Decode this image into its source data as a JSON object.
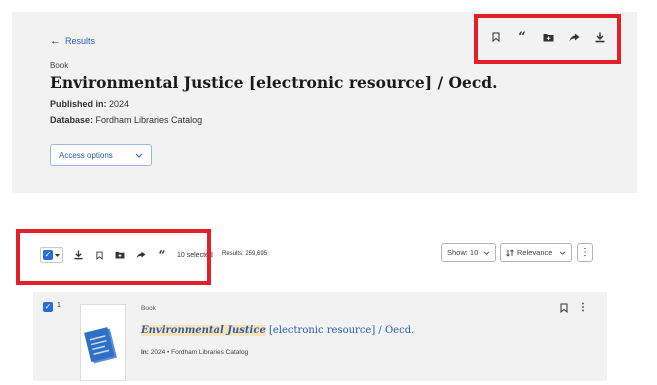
{
  "record": {
    "back_label": "Results",
    "type": "Book",
    "title": "Environmental Justice [electronic resource] / Oecd.",
    "published_label": "Published in:",
    "published_value": " 2024",
    "database_label": "Database:",
    "database_value": " Fordham Libraries Catalog",
    "access_button": "Access options",
    "actions": [
      "bookmark-icon",
      "cite-icon",
      "folder-icon",
      "share-icon",
      "download-icon"
    ]
  },
  "toolbar": {
    "selected_text": "10 selected",
    "results_text": "Results: 259,695",
    "show_label": "Show: 10",
    "sort_label": "Relevance"
  },
  "result": {
    "number": "1",
    "type": "Book",
    "title_highlight": "Environmental Justice",
    "title_rest": " [electronic resource] / Oecd.",
    "meta_label": "In:",
    "meta_value": " 2024 • Fordham Libraries Catalog"
  },
  "colors": {
    "accent": "#2a6cdb",
    "link": "#2a5db0",
    "highlight_box": "#e3202a",
    "panel": "#f2f2f2",
    "title_highlight": "#fbe3b8"
  }
}
